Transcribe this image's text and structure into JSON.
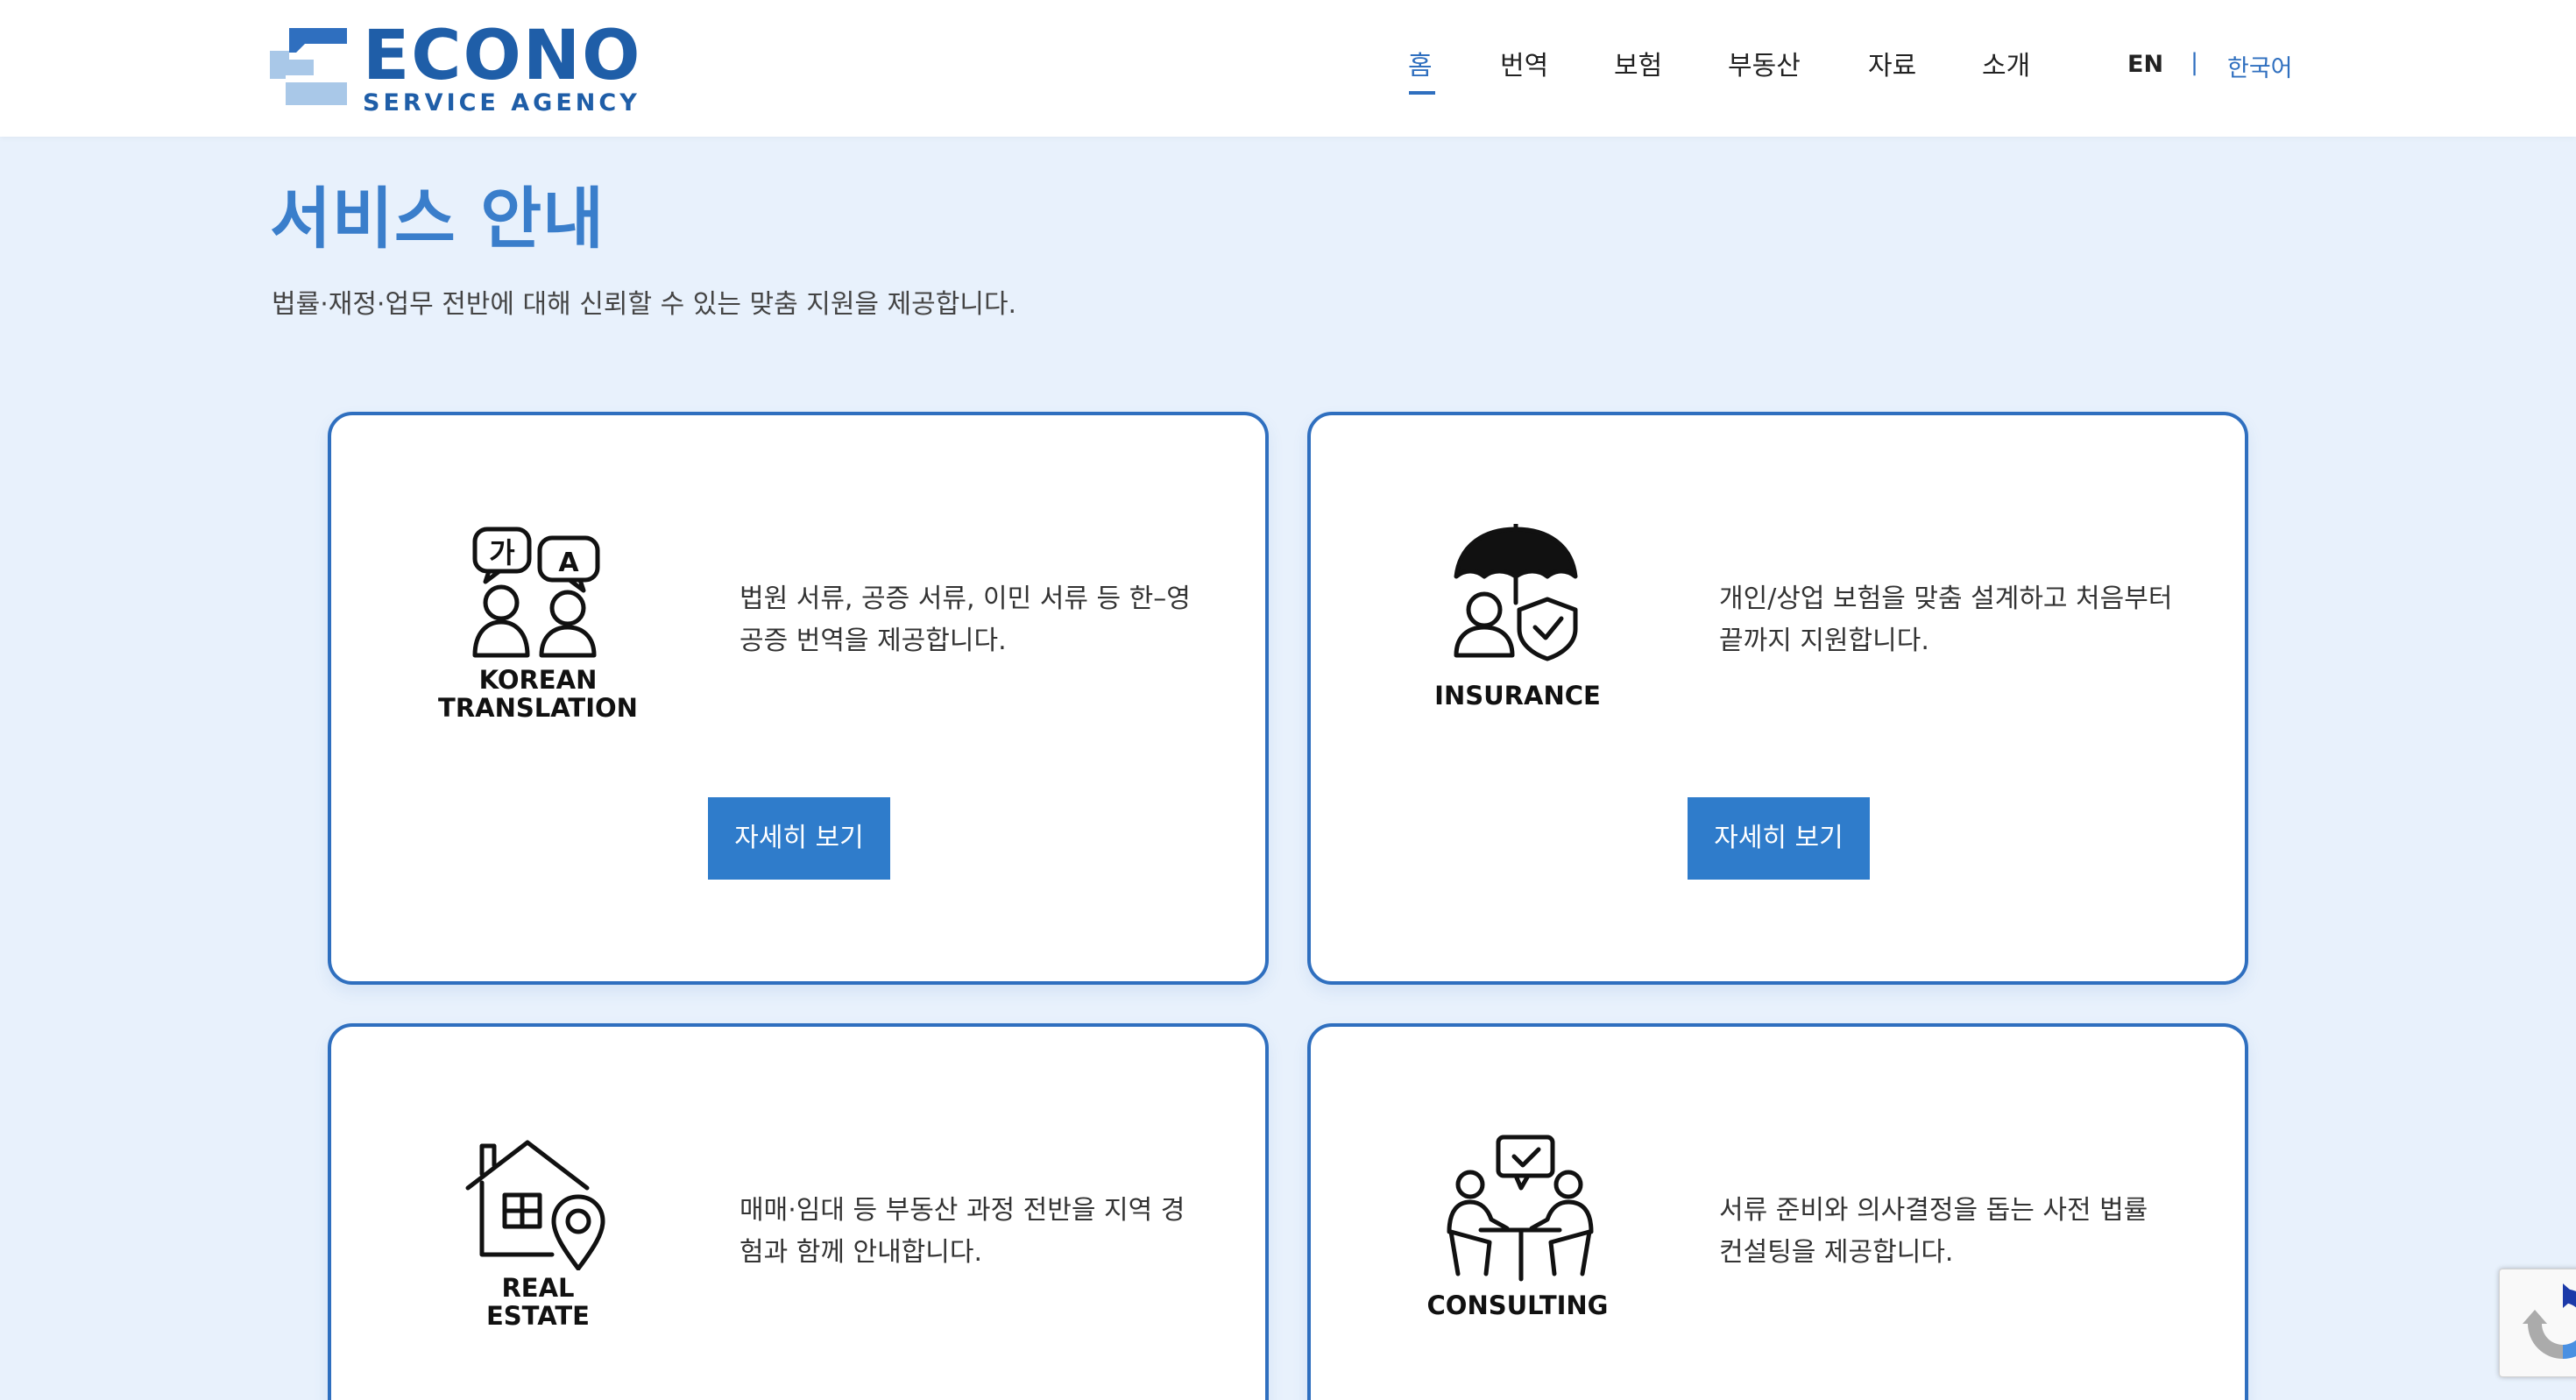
{
  "brand": {
    "name": "ECONO",
    "tagline": "SERVICE AGENCY",
    "colors": {
      "primary": "#1f5ea8",
      "accent": "#2f7ccb",
      "light": "#a9c8e8"
    }
  },
  "nav": {
    "items": [
      {
        "label": "홈",
        "active": true
      },
      {
        "label": "번역"
      },
      {
        "label": "보험"
      },
      {
        "label": "부동산"
      },
      {
        "label": "자료"
      },
      {
        "label": "소개"
      }
    ],
    "lang_en": "EN",
    "lang_sep": "|",
    "lang_ko": "한국어"
  },
  "page": {
    "title": "서비스 안내",
    "subtitle": "법률·재정·업무 전반에 대해 신뢰할 수 있는 맞춤 지원을 제공합니다."
  },
  "cards": [
    {
      "icon": "translation-icon",
      "icon_label_1": "KOREAN",
      "icon_label_2": "TRANSLATION",
      "desc_1": "법원 서류, 공증 서류, 이민 서류 등 한–영",
      "desc_2": "공증 번역을 제공합니다.",
      "button": "자세히 보기"
    },
    {
      "icon": "insurance-icon",
      "icon_label_1": "INSURANCE",
      "icon_label_2": "",
      "desc_1": "개인/상업 보험을 맞춤 설계하고 처음부터",
      "desc_2": "끝까지 지원합니다.",
      "button": "자세히 보기"
    },
    {
      "icon": "real-estate-icon",
      "icon_label_1": "REAL",
      "icon_label_2": "ESTATE",
      "desc_1": "매매·임대 등 부동산 과정 전반을 지역 경",
      "desc_2": "험과 함께 안내합니다.",
      "button": ""
    },
    {
      "icon": "consulting-icon",
      "icon_label_1": "CONSULTING",
      "icon_label_2": "",
      "desc_1": "서류 준비와 의사결정을 돕는 사전 법률",
      "desc_2": "컨설팅을 제공합니다.",
      "button": ""
    }
  ]
}
